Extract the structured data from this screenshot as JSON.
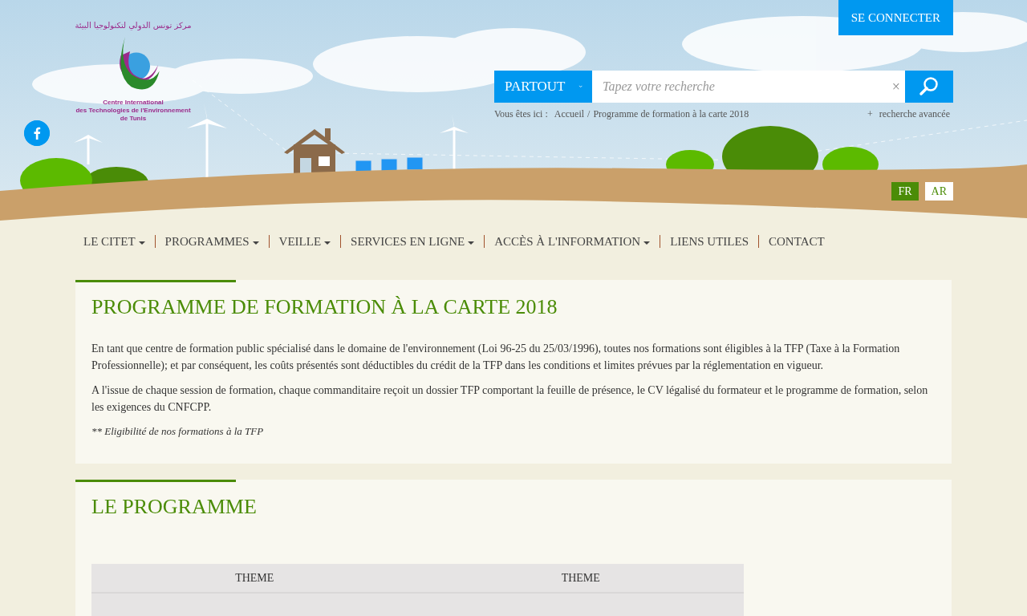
{
  "header": {
    "login_button": "SE CONNECTER",
    "logo": {
      "arabic": "مركز تونس الدولي لتكنولوجيا البيئة",
      "line1": "Centre International",
      "line2": "des Technologies de l'Environnement de Tunis"
    },
    "search": {
      "scope": "PARTOUT",
      "placeholder": "Tapez votre recherche",
      "clear": "×"
    },
    "breadcrumb": {
      "label": "Vous êtes ici :",
      "separator": "/",
      "items": [
        "Accueil",
        "Programme de formation à la carte 2018"
      ]
    },
    "advanced_search": {
      "icon": "+",
      "label": "recherche avancée"
    },
    "languages": [
      {
        "label": "FR",
        "selected": true
      },
      {
        "label": "AR",
        "selected": false
      }
    ]
  },
  "nav": [
    {
      "label": "LE CITET",
      "dropdown": true
    },
    {
      "label": "PROGRAMMES",
      "dropdown": true
    },
    {
      "label": "VEILLE",
      "dropdown": true
    },
    {
      "label": "SERVICES EN LIGNE",
      "dropdown": true
    },
    {
      "label": "ACCÈS À L'INFORMATION",
      "dropdown": true
    },
    {
      "label": "LIENS UTILES",
      "dropdown": false
    },
    {
      "label": "CONTACT",
      "dropdown": false
    }
  ],
  "sections": [
    {
      "title": "PROGRAMME DE FORMATION À LA CARTE 2018",
      "paragraphs": [
        "En tant que centre de formation public spécialisé dans le domaine de l'environnement (Loi 96-25 du 25/03/1996), toutes nos formations sont éligibles à la TFP (Taxe à la Formation Professionnelle); et par conséquent, les coûts présentés sont déductibles du crédit de la TFP dans les conditions et limites prévues par la réglementation en vigueur.",
        "A l'issue de chaque session de formation, chaque commanditaire reçoit un dossier TFP comportant la feuille de présence, le CV légalisé du formateur et le programme de formation, selon les exigences du CNFCPP."
      ],
      "note": "** Eligibilité de nos formations à la TFP"
    },
    {
      "title": "LE PROGRAMME",
      "table": {
        "columns": [
          "THEME",
          "THEME"
        ]
      }
    }
  ]
}
